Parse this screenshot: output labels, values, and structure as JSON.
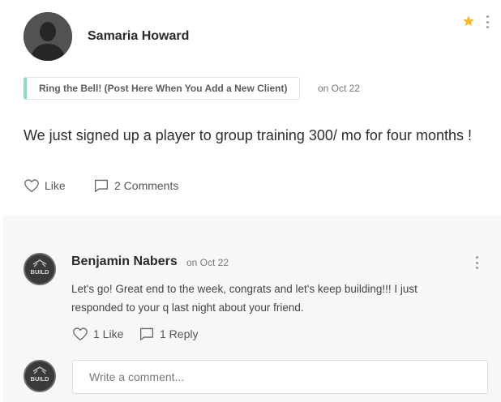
{
  "post": {
    "author": "Samaria Howard",
    "space": "Ring the Bell! (Post Here When You Add a New Client)",
    "date": "on Oct 22",
    "body": "We just signed up a player to group training 300/ mo for four months !",
    "like_label": "Like",
    "comments_label": "2 Comments",
    "starred": true
  },
  "comment": {
    "author": "Benjamin Nabers",
    "date": "on Oct 22",
    "text": "Let's go! Great end to the week, congrats and let's keep building!!! I just responded to your q last night about your friend.",
    "like_label": "1 Like",
    "reply_label": "1 Reply",
    "avatar_text": "BUILD"
  },
  "composer": {
    "placeholder": "Write a comment...",
    "avatar_text": "BUILD"
  },
  "colors": {
    "star": "#f5b82e",
    "tag_accent": "#8fdcc2"
  }
}
